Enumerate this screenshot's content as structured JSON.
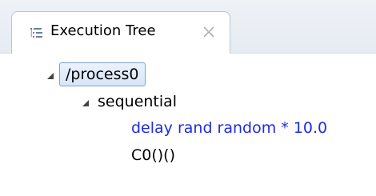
{
  "view": {
    "tab": {
      "icon": "tree-list-icon",
      "title": "Execution Tree",
      "close_icon": "close-icon"
    }
  },
  "tree": {
    "root": {
      "label": "/process0",
      "expanded": true,
      "children": [
        {
          "label": "sequential",
          "expanded": true,
          "children": [
            {
              "label": "delay rand random * 10.0",
              "color": "#1f2be0"
            },
            {
              "label": "C0()()",
              "color": "#000000"
            }
          ]
        }
      ]
    }
  }
}
